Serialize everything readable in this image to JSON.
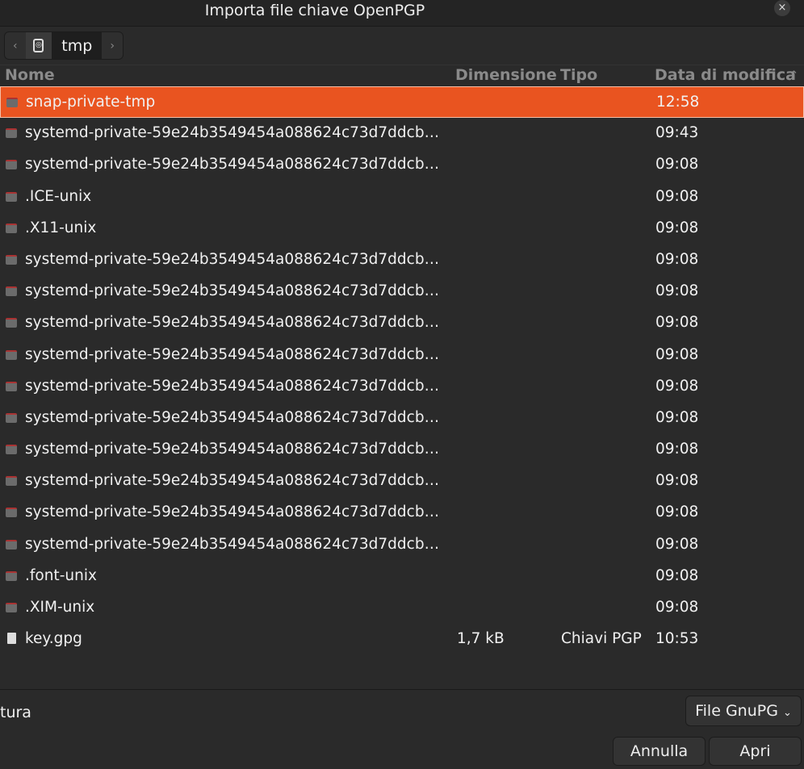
{
  "window": {
    "title": "Importa file chiave OpenPGP",
    "close": "×"
  },
  "pathbar": {
    "back": "‹",
    "current": "tmp",
    "forward": "›"
  },
  "columns": {
    "name": "Nome",
    "size": "Dimensione",
    "type": "Tipo",
    "date": "Data di modifica",
    "sort": "⌃"
  },
  "files": [
    {
      "name": "snap-private-tmp",
      "size": "",
      "type": "",
      "date": "12:58",
      "kind": "folder",
      "selected": true
    },
    {
      "name": "systemd-private-59e24b3549454a088624c73d7ddcb…",
      "size": "",
      "type": "",
      "date": "09:43",
      "kind": "folder"
    },
    {
      "name": "systemd-private-59e24b3549454a088624c73d7ddcb…",
      "size": "",
      "type": "",
      "date": "09:08",
      "kind": "folder"
    },
    {
      "name": ".ICE-unix",
      "size": "",
      "type": "",
      "date": "09:08",
      "kind": "folder"
    },
    {
      "name": ".X11-unix",
      "size": "",
      "type": "",
      "date": "09:08",
      "kind": "folder"
    },
    {
      "name": "systemd-private-59e24b3549454a088624c73d7ddcb…",
      "size": "",
      "type": "",
      "date": "09:08",
      "kind": "folder"
    },
    {
      "name": "systemd-private-59e24b3549454a088624c73d7ddcb…",
      "size": "",
      "type": "",
      "date": "09:08",
      "kind": "folder"
    },
    {
      "name": "systemd-private-59e24b3549454a088624c73d7ddcb…",
      "size": "",
      "type": "",
      "date": "09:08",
      "kind": "folder"
    },
    {
      "name": "systemd-private-59e24b3549454a088624c73d7ddcb…",
      "size": "",
      "type": "",
      "date": "09:08",
      "kind": "folder"
    },
    {
      "name": "systemd-private-59e24b3549454a088624c73d7ddcb…",
      "size": "",
      "type": "",
      "date": "09:08",
      "kind": "folder"
    },
    {
      "name": "systemd-private-59e24b3549454a088624c73d7ddcb…",
      "size": "",
      "type": "",
      "date": "09:08",
      "kind": "folder"
    },
    {
      "name": "systemd-private-59e24b3549454a088624c73d7ddcb…",
      "size": "",
      "type": "",
      "date": "09:08",
      "kind": "folder"
    },
    {
      "name": "systemd-private-59e24b3549454a088624c73d7ddcb…",
      "size": "",
      "type": "",
      "date": "09:08",
      "kind": "folder"
    },
    {
      "name": "systemd-private-59e24b3549454a088624c73d7ddcb…",
      "size": "",
      "type": "",
      "date": "09:08",
      "kind": "folder"
    },
    {
      "name": "systemd-private-59e24b3549454a088624c73d7ddcb…",
      "size": "",
      "type": "",
      "date": "09:08",
      "kind": "folder"
    },
    {
      "name": ".font-unix",
      "size": "",
      "type": "",
      "date": "09:08",
      "kind": "folder"
    },
    {
      "name": ".XIM-unix",
      "size": "",
      "type": "",
      "date": "09:08",
      "kind": "folder"
    },
    {
      "name": "key.gpg",
      "size": "1,7 kB",
      "type": "Chiavi PGP",
      "date": "10:53",
      "kind": "file"
    }
  ],
  "footer": {
    "partial_label": "tura",
    "filter": "File GnuPG",
    "filter_arrow": "⌄",
    "cancel": "Annulla",
    "open": "Apri"
  },
  "colors": {
    "accent": "#e95420"
  }
}
